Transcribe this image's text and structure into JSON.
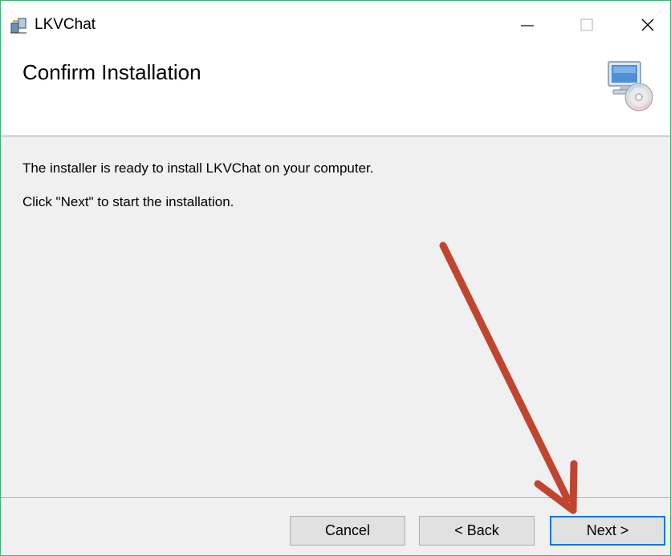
{
  "window": {
    "title": "LKVChat",
    "border_color": "#3cb371"
  },
  "header": {
    "title": "Confirm Installation",
    "icon": "computer-cd-icon"
  },
  "body": {
    "line1": "The installer is ready to install LKVChat on your computer.",
    "line2": "Click \"Next\" to start the installation."
  },
  "footer": {
    "cancel_label": "Cancel",
    "back_label": "< Back",
    "next_label": "Next >"
  },
  "annotation": {
    "icon": "red-arrow-annotation",
    "color": "#c0452f"
  }
}
